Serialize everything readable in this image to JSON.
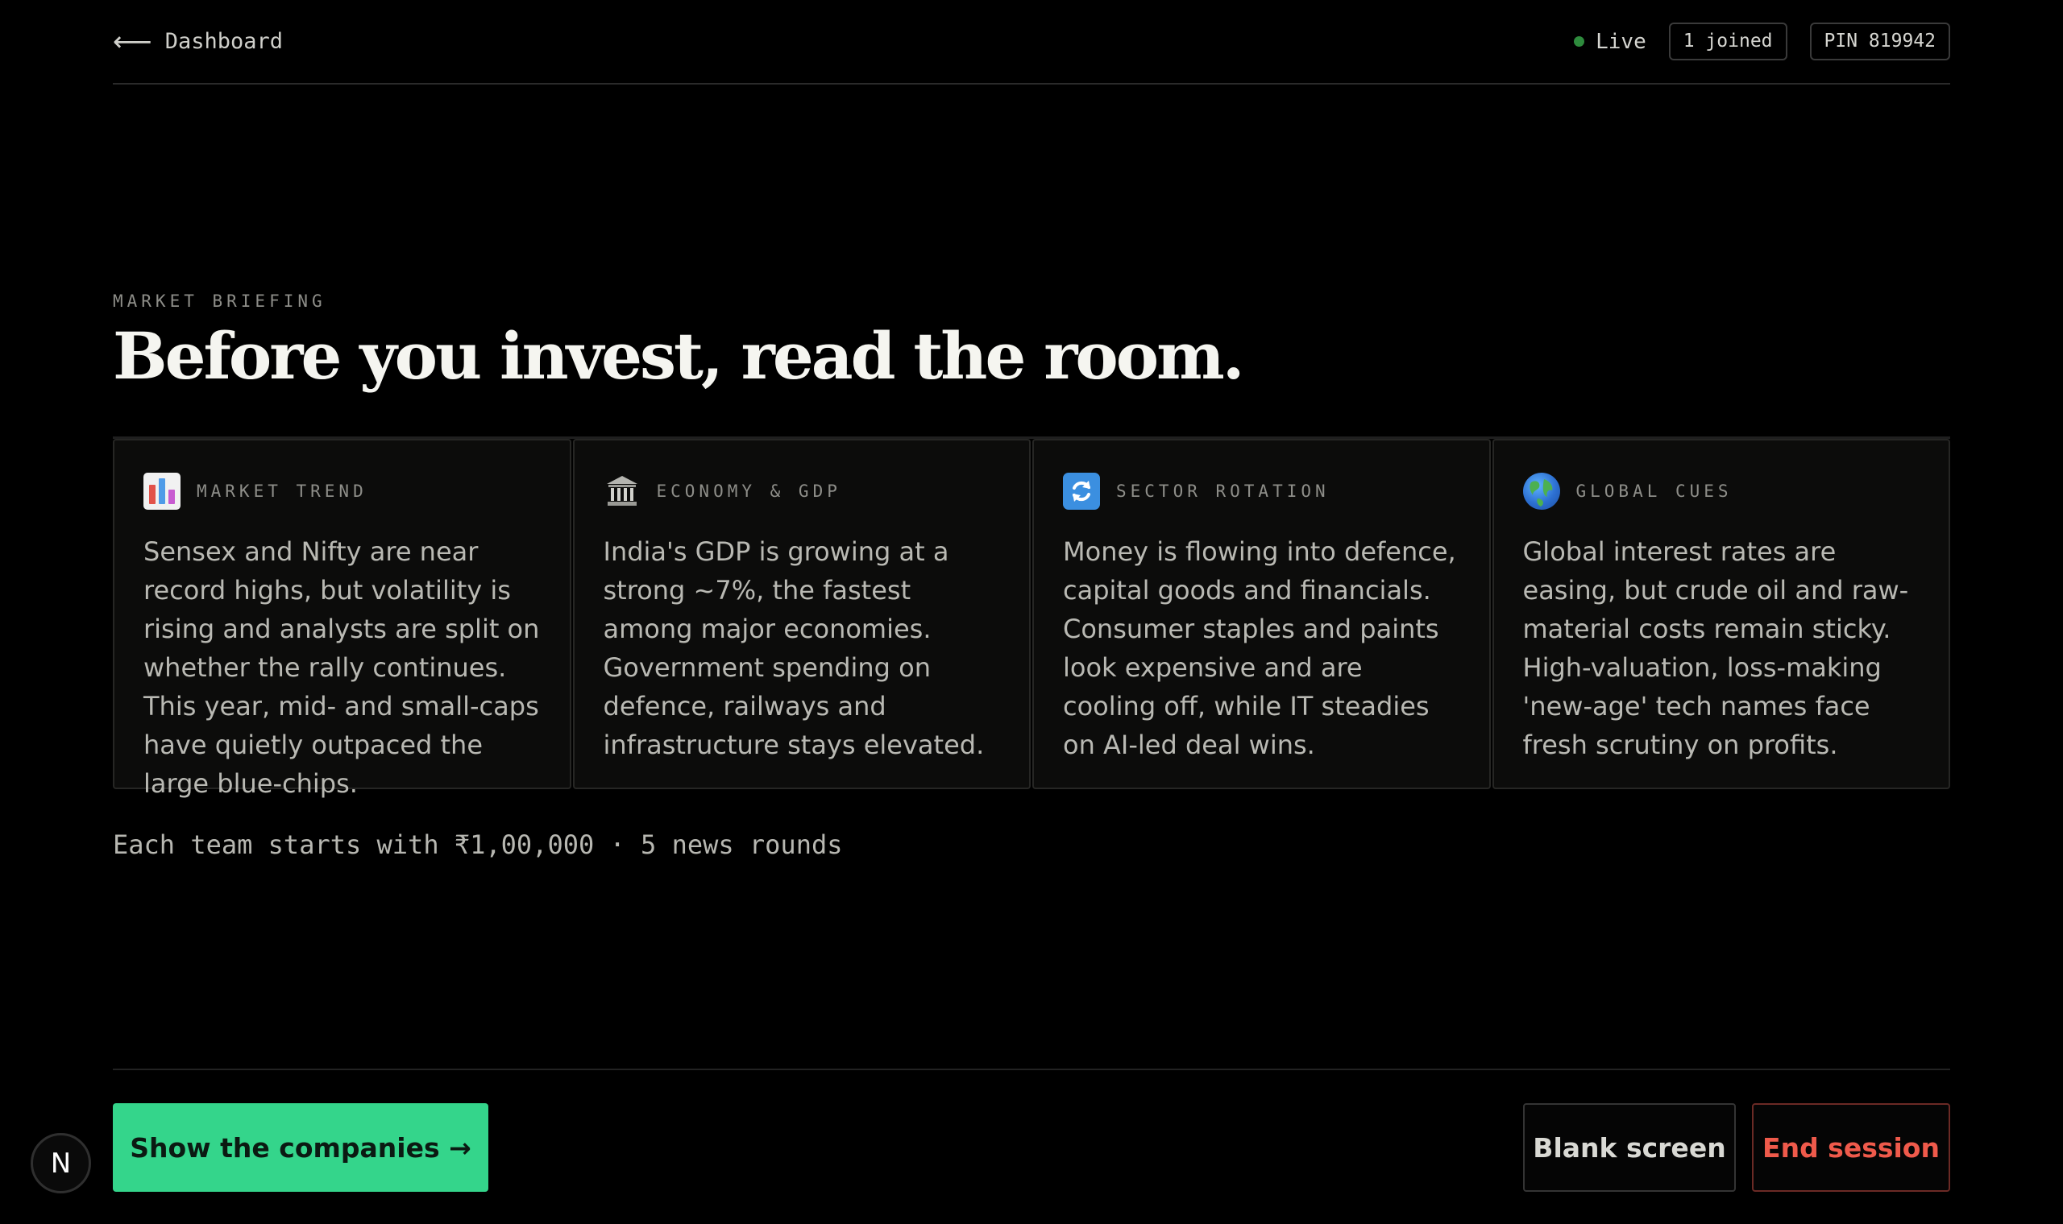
{
  "header": {
    "back_arrow": "⟵",
    "back_label": "Dashboard",
    "live_label": "Live",
    "joined_label": "1 joined",
    "pin_label": "PIN 819942"
  },
  "hero": {
    "eyebrow": "MARKET BRIEFING",
    "headline": "Before you invest, read the room."
  },
  "cards": [
    {
      "icon": "bar-chart-icon",
      "title": "MARKET TREND",
      "body": "Sensex and Nifty are near record highs, but volatility is rising and analysts are split on whether the rally continues. This year, mid- and small-caps have quietly outpaced the large blue-chips."
    },
    {
      "icon": "bank-icon",
      "title": "ECONOMY & GDP",
      "body": "India's GDP is growing at a strong ~7%, the fastest among major economies. Government spending on defence, railways and infrastructure stays elevated."
    },
    {
      "icon": "rotate-icon",
      "title": "SECTOR ROTATION",
      "body": "Money is flowing into defence, capital goods and financials. Consumer staples and paints look expensive and are cooling off, while IT steadies on AI-led deal wins."
    },
    {
      "icon": "globe-icon",
      "title": "GLOBAL CUES",
      "body": "Global interest rates are easing, but crude oil and raw-material costs remain sticky. High-valuation, loss-making 'new-age' tech names face fresh scrutiny on profits."
    }
  ],
  "budget_line": "Each team starts with ₹1,00,000 · 5 news rounds",
  "actions": {
    "primary_label": "Show the companies →",
    "blank_label": "Blank screen",
    "end_label": "End session"
  },
  "dev_badge_label": "N",
  "colors": {
    "accent_green": "#34d58b",
    "danger_red": "#ef5a4b",
    "live_dot": "#2e8b3d",
    "background": "#000000"
  }
}
